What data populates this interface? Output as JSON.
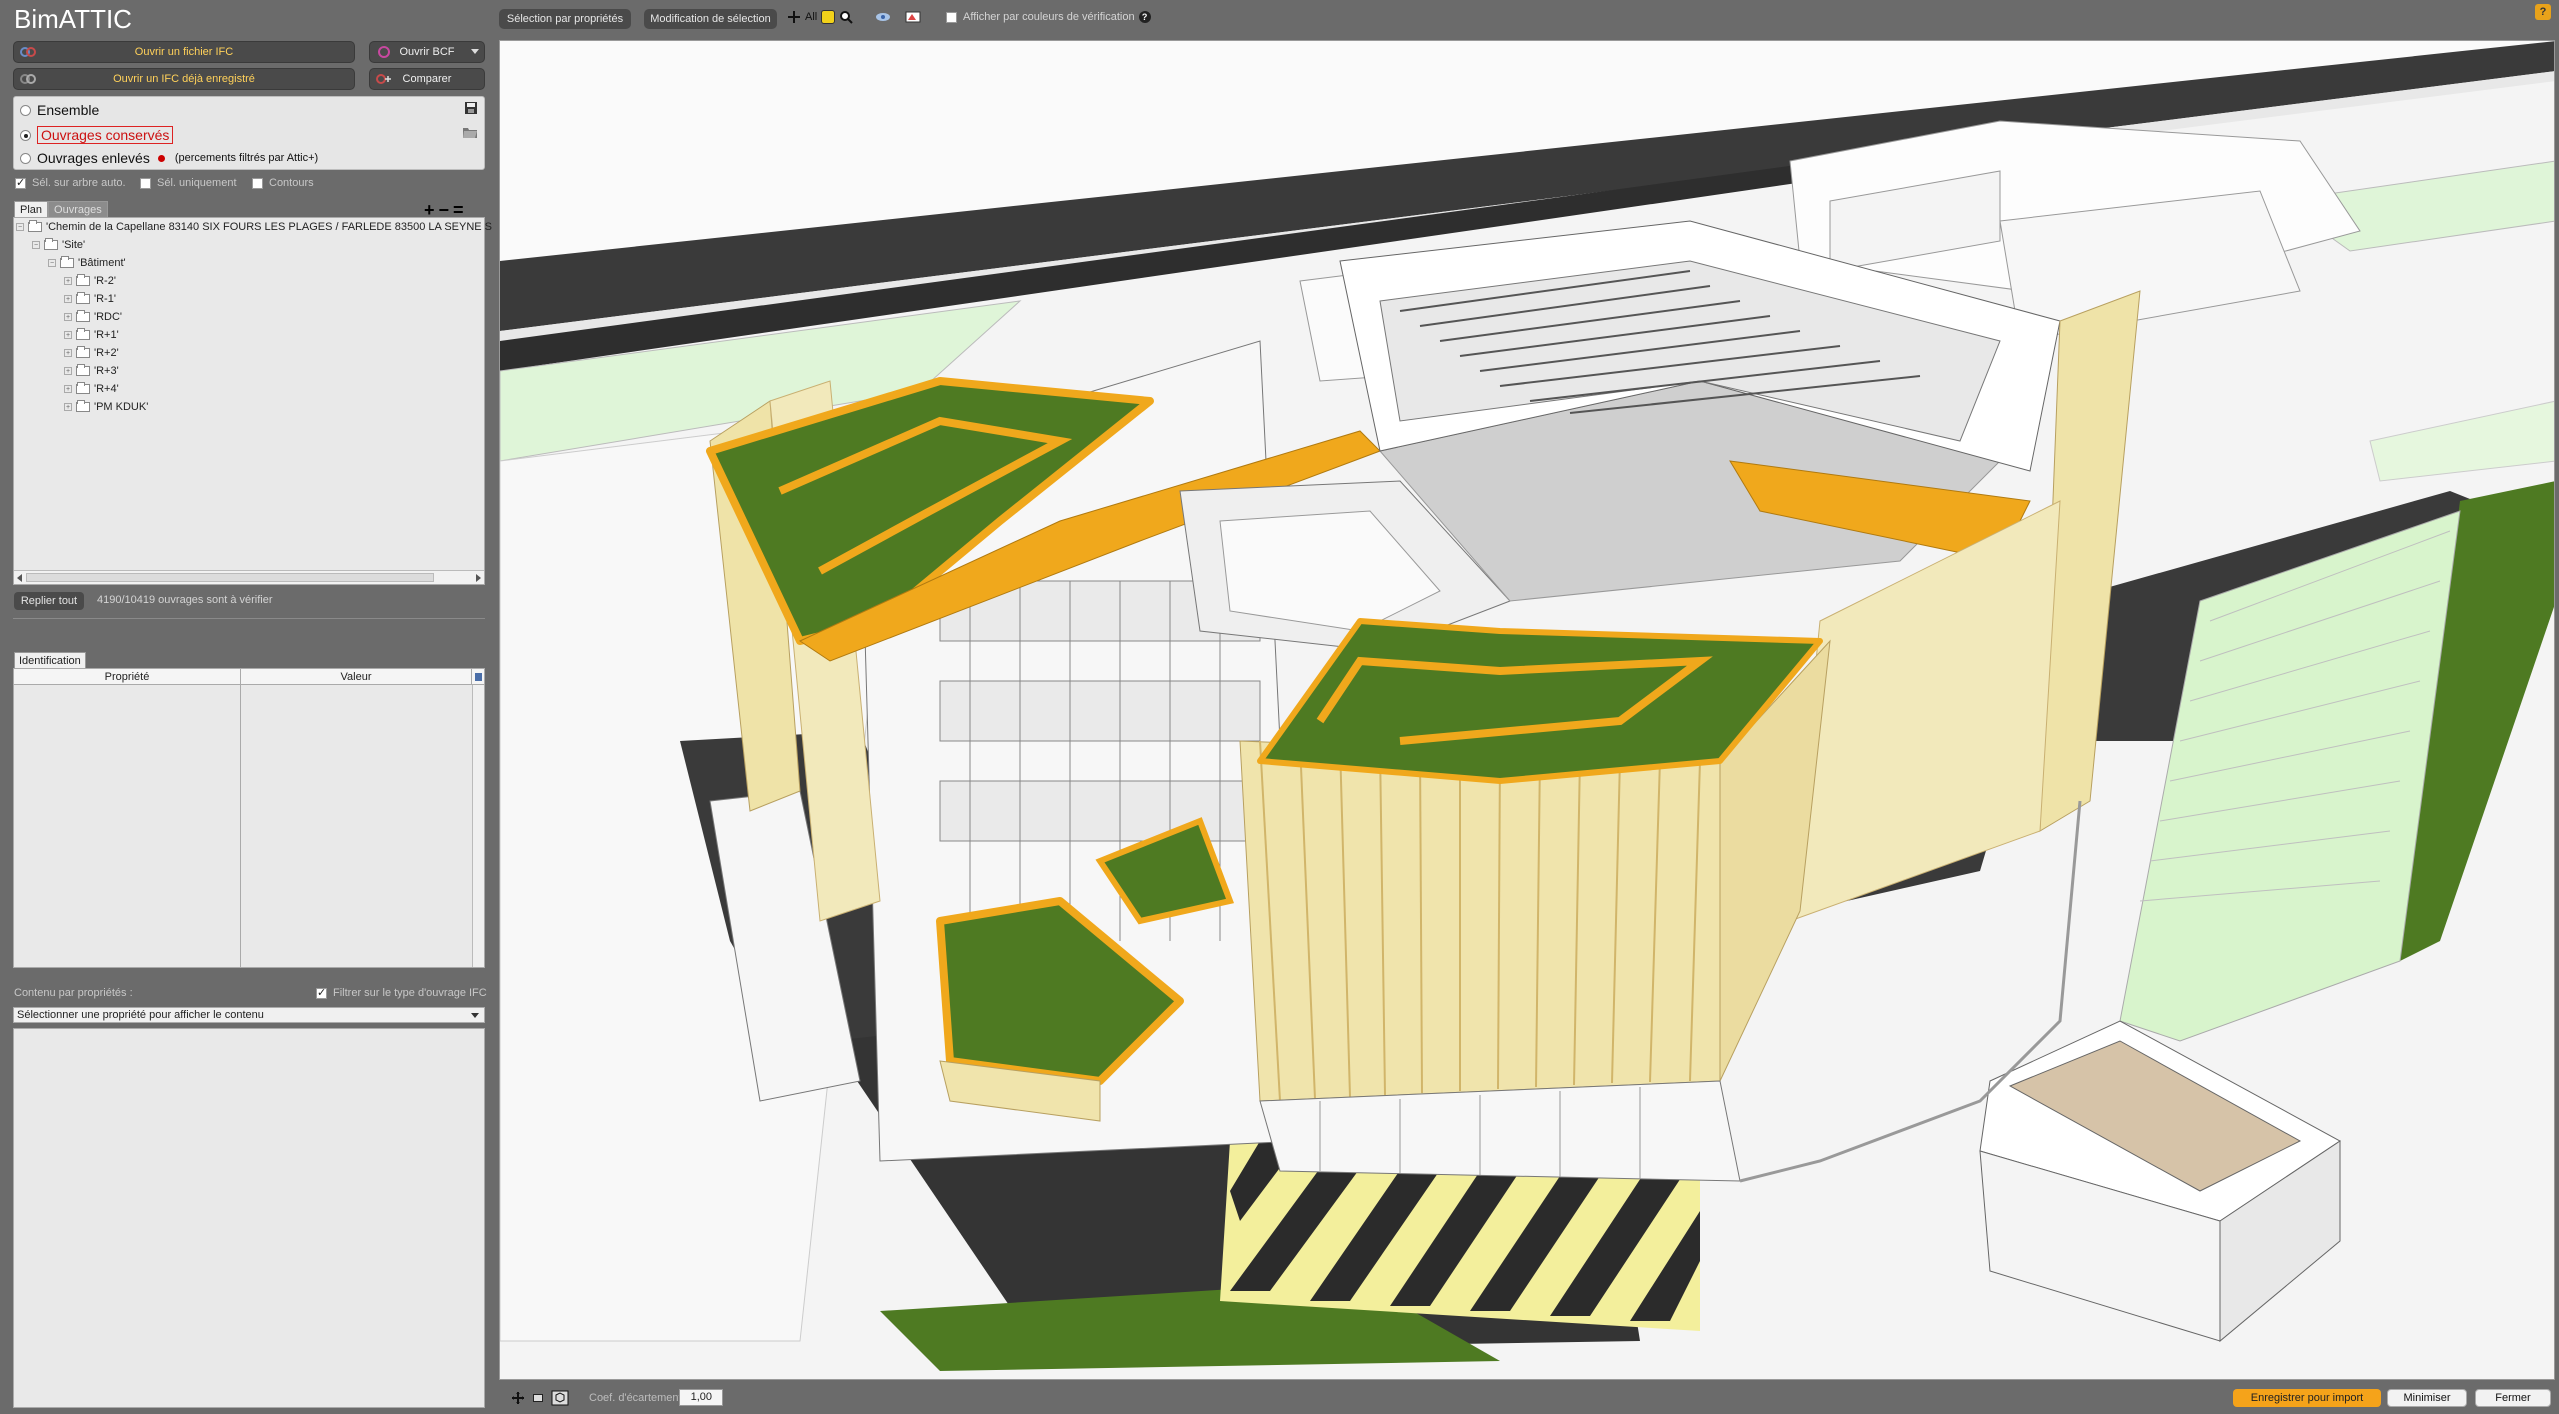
{
  "app": {
    "title": "BimATTIC"
  },
  "left": {
    "open_ifc": "Ouvrir un fichier IFC",
    "open_bcf": "Ouvrir BCF",
    "open_saved_ifc": "Ouvrir un IFC déjà enregistré",
    "compare": "Comparer",
    "modes": [
      {
        "label": "Ensemble",
        "selected": false
      },
      {
        "label": "Ouvrages conservés",
        "selected": true
      },
      {
        "label": "Ouvrages enlevés",
        "selected": false,
        "note": "(percements filtrés par Attic+)"
      }
    ],
    "options": {
      "sel_auto": "Sél. sur arbre auto.",
      "sel_only": "Sél. uniquement",
      "contours": "Contours"
    },
    "tabs": {
      "plan": "Plan",
      "ouvrages": "Ouvrages"
    },
    "tree": {
      "root": "'Chemin de la Capellane 83140 SIX FOURS LES PLAGES / FARLEDE 83500 LA SEYNE S",
      "site": "'Site'",
      "building": "'Bâtiment'",
      "levels": [
        "'R-2'",
        "'R-1'",
        "'RDC'",
        "'R+1'",
        "'R+2'",
        "'R+3'",
        "'R+4'",
        "'PM KDUK'"
      ]
    },
    "collapse_all": "Replier tout",
    "count_text": "4190/10419 ouvrages sont à vérifier",
    "identification_tab": "Identification",
    "prop_table": {
      "col_property": "Propriété",
      "col_value": "Valeur"
    },
    "contenu_label": "Contenu par propriétés :",
    "filter_label": "Filtrer sur le type d'ouvrage IFC",
    "select_placeholder": "Sélectionner une propriété pour afficher le contenu"
  },
  "toolbar": {
    "select_by_props": "Sélection par propriétés",
    "modify_selection": "Modification de sélection",
    "all_label": "All",
    "show_verif_colors": "Afficher par couleurs de vérification",
    "help": "?"
  },
  "bottom": {
    "coef_label": "Coef. d'écartement",
    "coef_value": "1,00",
    "save_import": "Enregistrer pour import",
    "minimize": "Minimiser",
    "close": "Fermer"
  },
  "colors": {
    "accent_orange": "#f5a31a",
    "roof_green": "#4e7a22",
    "roof_edge": "#f0a81c",
    "facade_slats": "#efe3a8",
    "asphalt": "#3a3a3a",
    "grass_light": "#d8f4cc"
  },
  "icons": {
    "open_ifc": "ifc-file-icon",
    "open_bcf": "bcf-icon",
    "open_saved": "saved-ifc-icon",
    "compare": "compare-icon",
    "save": "floppy-save-icon",
    "folder": "folder-open-icon",
    "add": "plus-icon",
    "remove": "minus-icon",
    "equal": "equal-icon"
  }
}
